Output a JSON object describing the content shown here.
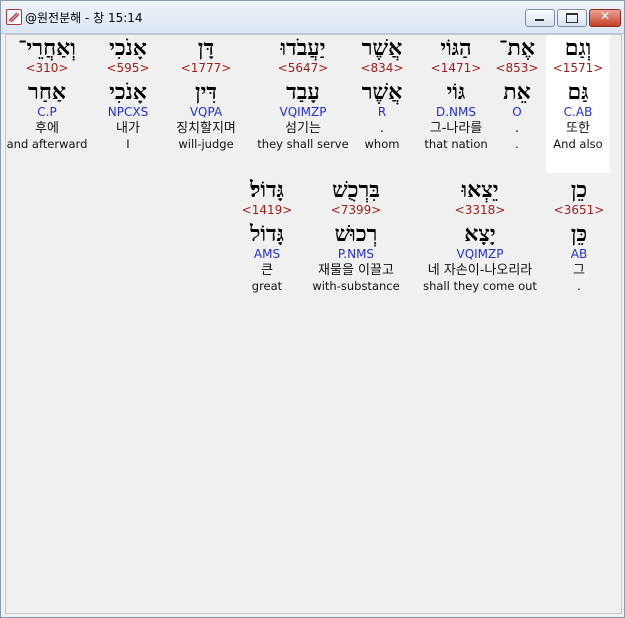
{
  "window": {
    "title": "@원전분해 - 창 15:14",
    "close_glyph": "✕"
  },
  "rows": [
    [
      {
        "heb": "וְאַחֲרֵי־",
        "strong": "<310>",
        "lemma": "אַחַר",
        "parse": "C.P",
        "kor": "후에",
        "eng": "and afterward"
      },
      {
        "heb": "אָנֹכִי",
        "strong": "<595>",
        "lemma": "אָנֹכִי",
        "parse": "NPCXS",
        "kor": "내가",
        "eng": "I"
      },
      {
        "heb": "דָּן",
        "strong": "<1777>",
        "lemma": "דִּין",
        "parse": "VQPA",
        "kor": "징치할지며",
        "eng": "will-judge"
      },
      {
        "heb": "יַעֲבֹדוּ",
        "strong": "<5647>",
        "lemma": "עָבַד",
        "parse": "VQIMZP",
        "kor": "섬기는",
        "eng": "they shall serve"
      },
      {
        "heb": "אֲשֶׁר",
        "strong": "<834>",
        "lemma": "אֲשֶׁר",
        "parse": "R",
        "kor": ".",
        "eng": "whom"
      },
      {
        "heb": "הַגּוֹי",
        "strong": "<1471>",
        "lemma": "גּוֹי",
        "parse": "D.NMS",
        "kor": "그-나라를",
        "eng": "that nation"
      },
      {
        "heb": "אֶת־",
        "strong": "<853>",
        "lemma": "אֵת",
        "parse": "O",
        "kor": ".",
        "eng": "."
      },
      {
        "heb": "וְגַם",
        "strong": "<1571>",
        "lemma": "גַּם",
        "parse": "C.AB",
        "kor": "또한",
        "eng": "And also"
      }
    ],
    [
      {
        "heb": "גָּדוֹל׃",
        "strong": "<1419>",
        "lemma": "גָּדוֹל",
        "parse": "AMS",
        "kor": "큰",
        "eng": "great"
      },
      {
        "heb": "בִּרְכֻשׁ",
        "strong": "<7399>",
        "lemma": "רְכוּשׁ",
        "parse": "P.NMS",
        "kor": "재물을 이끌고",
        "eng": "with-substance"
      },
      {
        "heb": "יֵצְאוּ",
        "strong": "<3318>",
        "lemma": "יָצָא",
        "parse": "VQIMZP",
        "kor": "네 자손이-나오리라",
        "eng": "shall they come out"
      },
      {
        "heb": "כֵן",
        "strong": "<3651>",
        "lemma": "כֵּן",
        "parse": "AB",
        "kor": "그",
        "eng": "."
      }
    ]
  ]
}
